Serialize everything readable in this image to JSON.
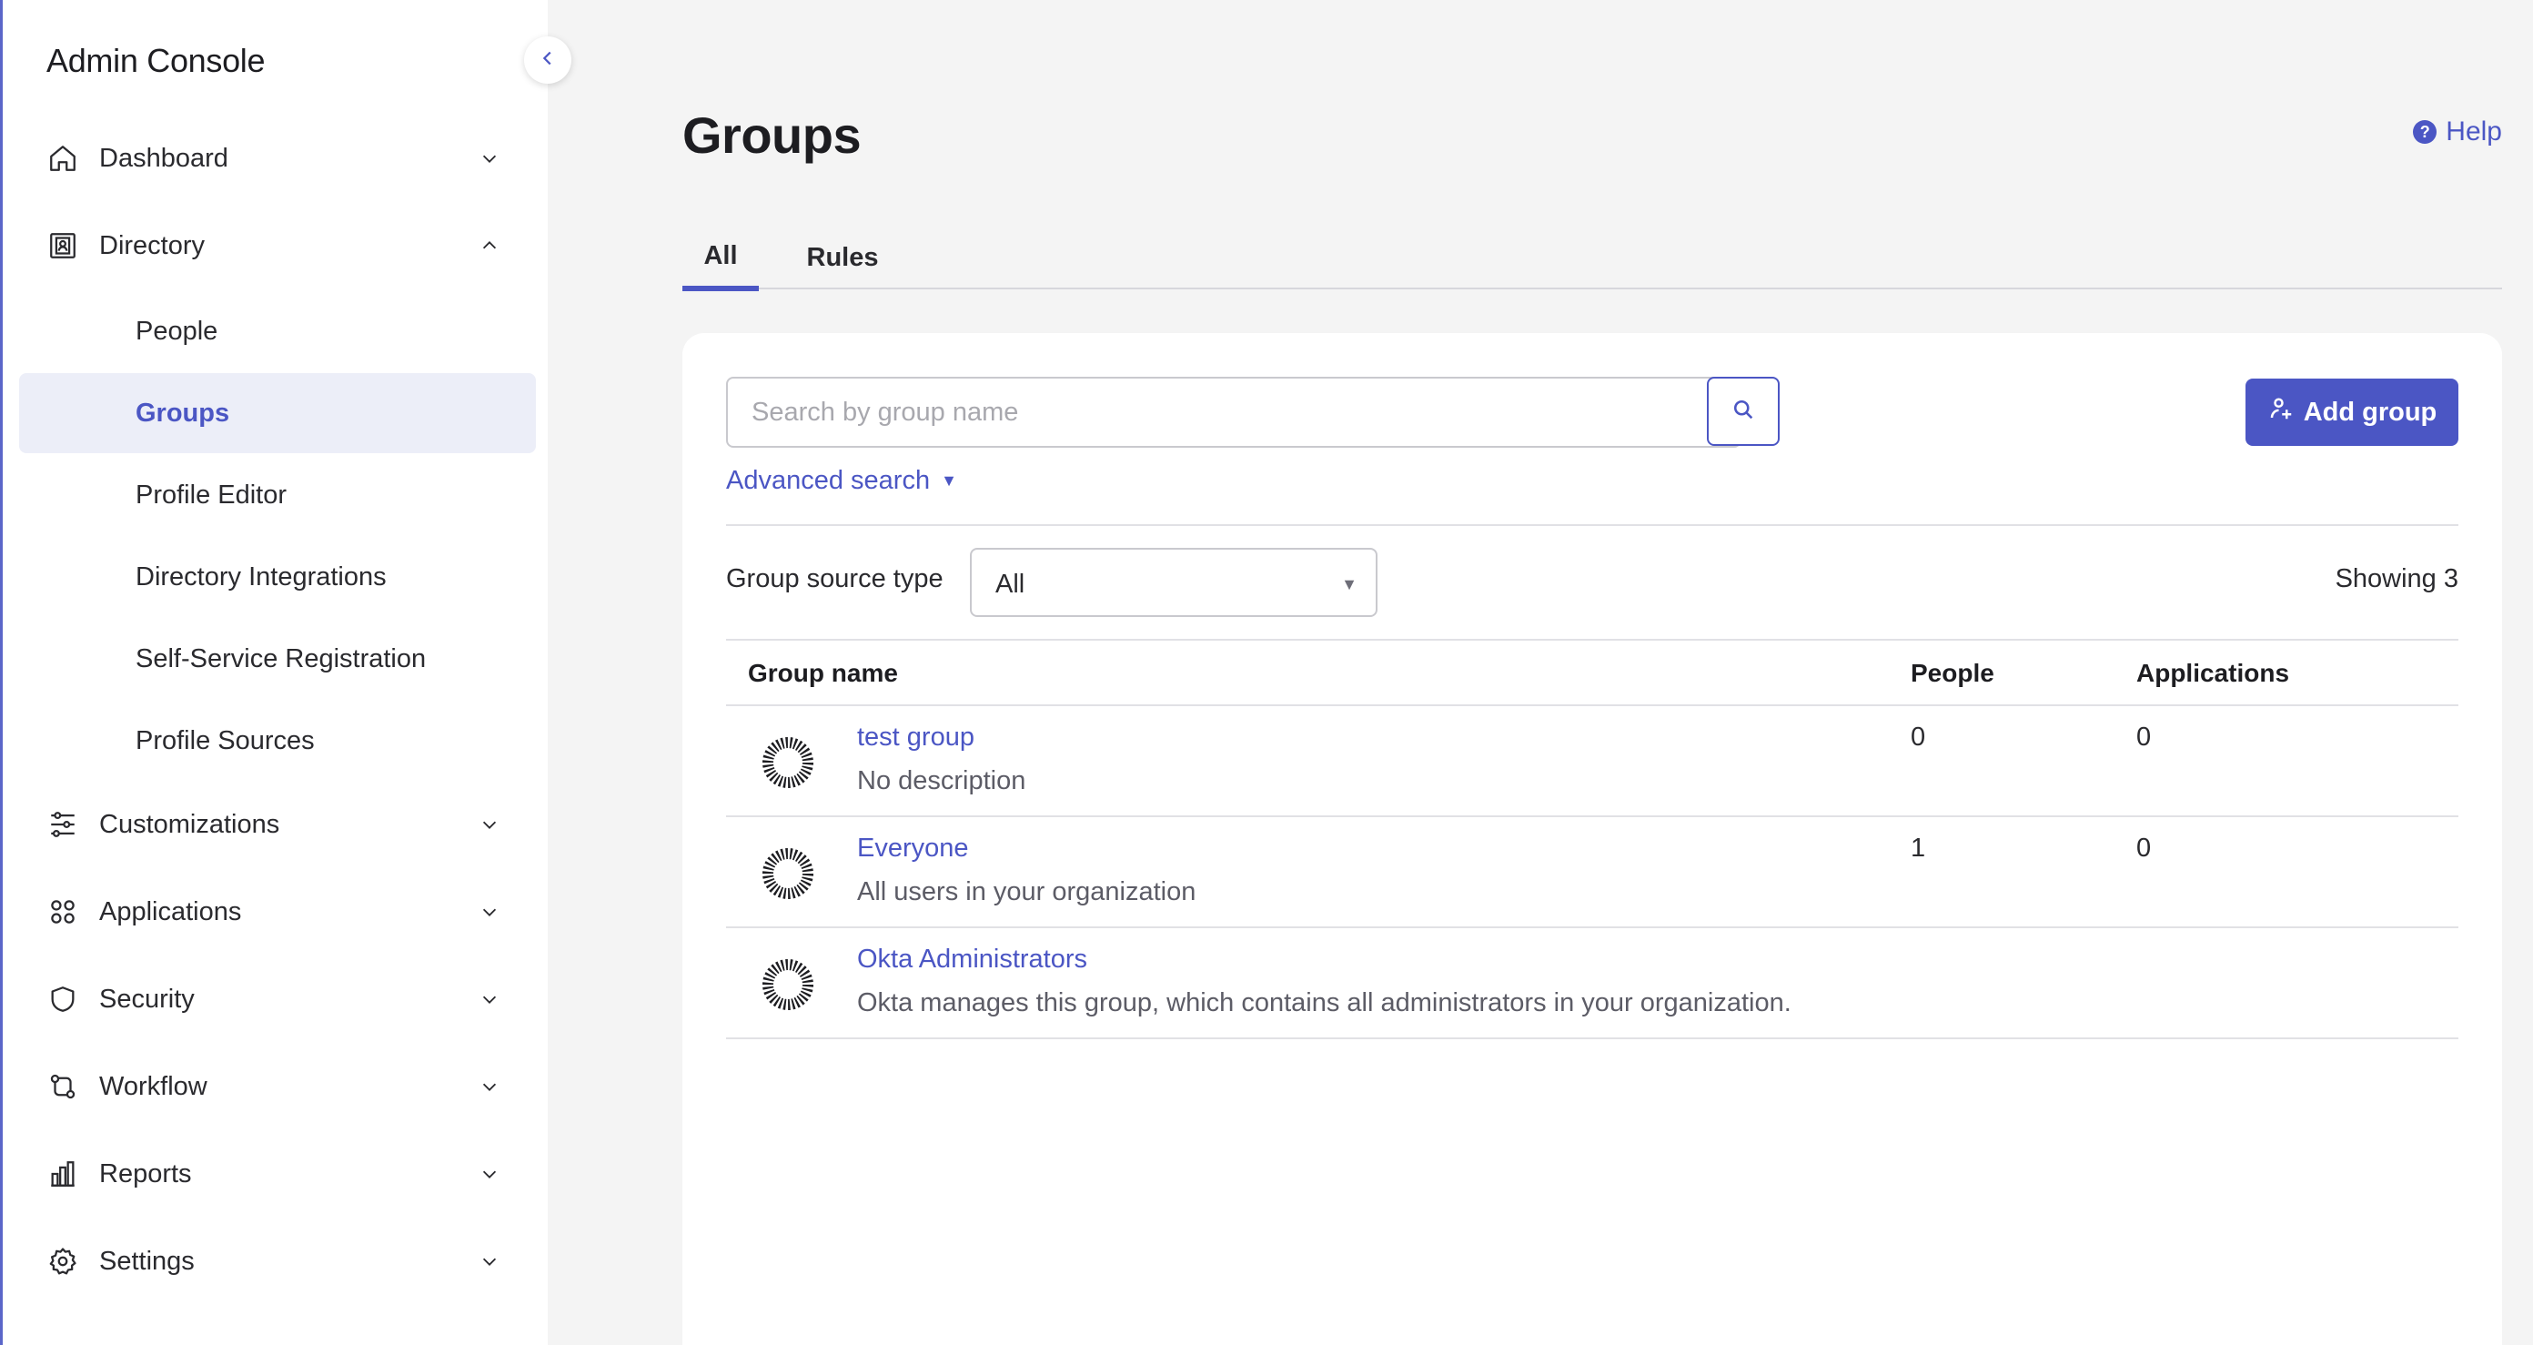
{
  "sidebar": {
    "brand": "Admin Console",
    "nav": {
      "dashboard": "Dashboard",
      "directory": "Directory",
      "customizations": "Customizations",
      "applications": "Applications",
      "security": "Security",
      "workflow": "Workflow",
      "reports": "Reports",
      "settings": "Settings"
    },
    "directory_items": {
      "people": "People",
      "groups": "Groups",
      "profile_editor": "Profile Editor",
      "directory_integrations": "Directory Integrations",
      "self_service_registration": "Self-Service Registration",
      "profile_sources": "Profile Sources"
    },
    "active_item": "Groups"
  },
  "header": {
    "title": "Groups",
    "help": "Help"
  },
  "tabs": {
    "all": "All",
    "rules": "Rules",
    "active": "All"
  },
  "toolbar": {
    "search_placeholder": "Search by group name",
    "search_value": "",
    "add_group": "Add group",
    "advanced_search": "Advanced search",
    "filter_label": "Group source type",
    "filter_value": "All",
    "showing": "Showing 3"
  },
  "table": {
    "headers": {
      "name": "Group name",
      "people": "People",
      "applications": "Applications"
    },
    "rows": [
      {
        "name": "test group",
        "description": "No description",
        "people": "0",
        "applications": "0"
      },
      {
        "name": "Everyone",
        "description": "All users in your organization",
        "people": "1",
        "applications": "0"
      },
      {
        "name": "Okta Administrators",
        "description": "Okta manages this group, which contains all administrators in your organization.",
        "people": "",
        "applications": ""
      }
    ]
  },
  "colors": {
    "accent": "#4b56c4",
    "active_bg": "#eceef8",
    "page_bg": "#f4f4f4"
  },
  "icons": {
    "collapse": "chevron-left-icon",
    "search": "search-icon",
    "add_group": "add-user-icon",
    "group": "okta-sunburst-icon",
    "help": "question-circle-icon"
  }
}
